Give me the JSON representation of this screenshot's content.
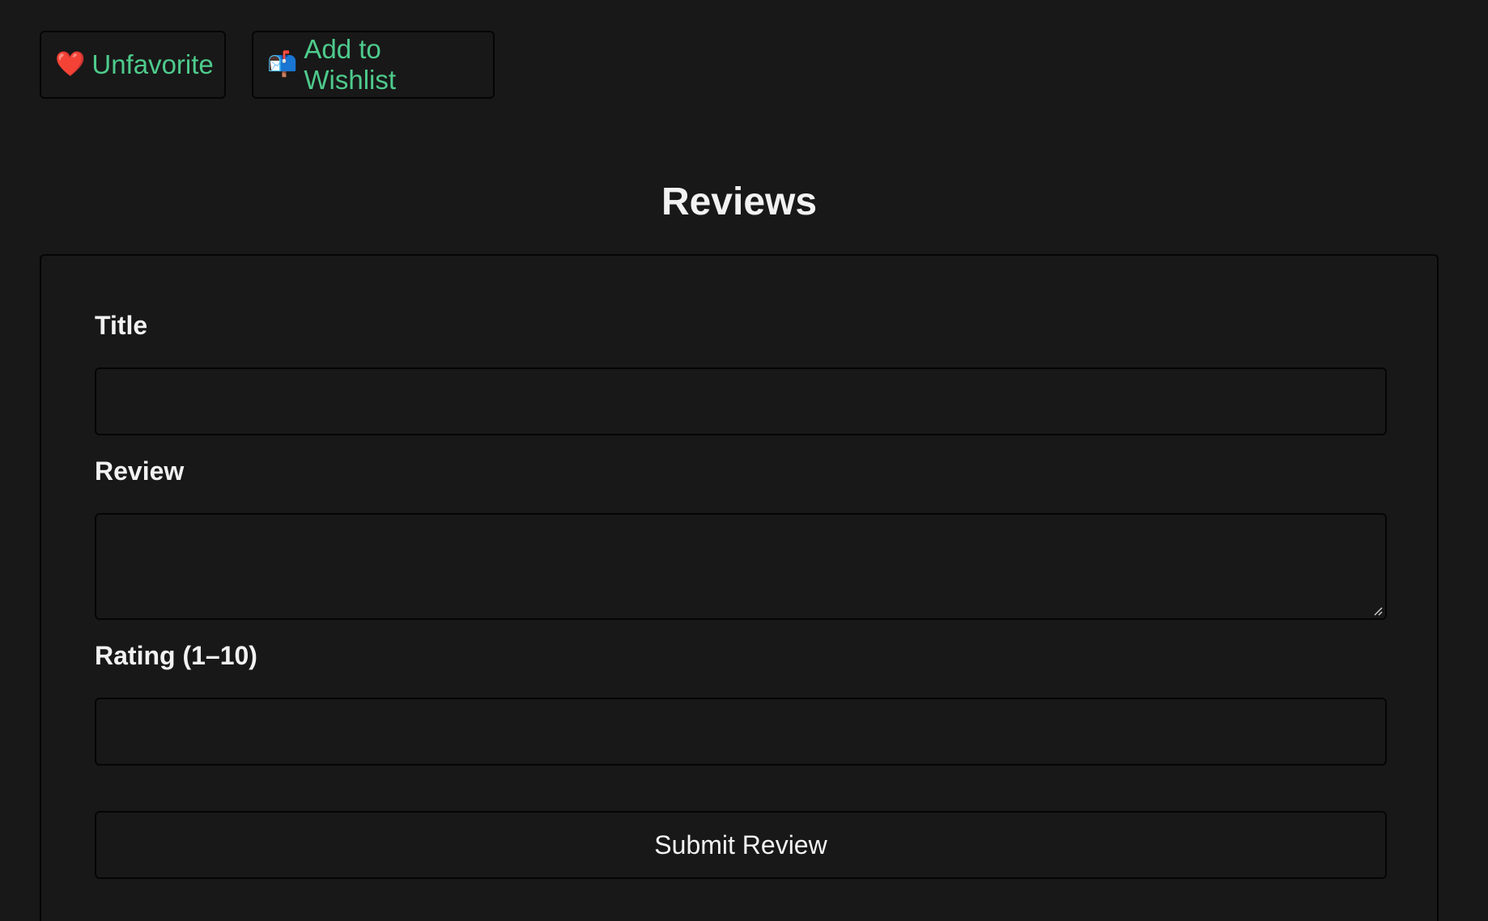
{
  "actions": {
    "unfavorite": {
      "icon": "❤️",
      "icon_name": "heart-icon",
      "label": "Unfavorite"
    },
    "wishlist": {
      "icon": "📬",
      "icon_name": "mailbox-icon",
      "label": "Add to Wishlist"
    }
  },
  "reviews": {
    "heading": "Reviews",
    "form": {
      "title_label": "Title",
      "title_value": "",
      "review_label": "Review",
      "review_value": "",
      "rating_label": "Rating (1–10)",
      "rating_value": "",
      "submit_label": "Submit Review"
    }
  },
  "colors": {
    "background": "#181818",
    "accent": "#4ecb8c",
    "text": "#f2f2f2",
    "border": "#050505"
  }
}
